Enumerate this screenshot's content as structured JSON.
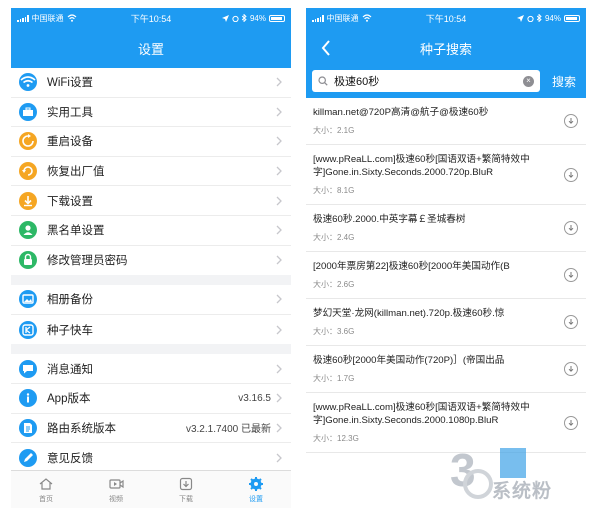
{
  "status_bar": {
    "carrier": "中国联通",
    "time": "下午10:54",
    "battery": "94%"
  },
  "settings": {
    "title": "设置",
    "groups": [
      [
        {
          "label": "WiFi设置",
          "icon": "wifi-icon",
          "color": "#1e9bf2"
        },
        {
          "label": "实用工具",
          "icon": "toolbox-icon",
          "color": "#1e9bf2"
        },
        {
          "label": "重启设备",
          "icon": "restart-icon",
          "color": "#f5a623"
        },
        {
          "label": "恢复出厂值",
          "icon": "factory-reset-icon",
          "color": "#f5a623"
        },
        {
          "label": "下载设置",
          "icon": "download-settings-icon",
          "color": "#f5a623"
        },
        {
          "label": "黑名单设置",
          "icon": "blacklist-icon",
          "color": "#2db866"
        },
        {
          "label": "修改管理员密码",
          "icon": "lock-icon",
          "color": "#2db866"
        }
      ],
      [
        {
          "label": "相册备份",
          "icon": "photo-backup-icon",
          "color": "#1e9bf2"
        },
        {
          "label": "种子快车",
          "icon": "torrent-express-icon",
          "color": "#1e9bf2"
        }
      ],
      [
        {
          "label": "消息通知",
          "icon": "message-icon",
          "color": "#1e9bf2"
        },
        {
          "label": "App版本",
          "value": "v3.16.5",
          "icon": "info-icon",
          "color": "#1e9bf2"
        },
        {
          "label": "路由系统版本",
          "value": "v3.2.1.7400 已最新",
          "icon": "document-icon",
          "color": "#1e9bf2"
        },
        {
          "label": "意见反馈",
          "icon": "feedback-icon",
          "color": "#1e9bf2"
        }
      ]
    ],
    "tabs": [
      {
        "label": "首页",
        "icon": "home-icon",
        "active": false
      },
      {
        "label": "视频",
        "icon": "video-icon",
        "active": false
      },
      {
        "label": "下载",
        "icon": "download-icon",
        "active": false
      },
      {
        "label": "设置",
        "icon": "settings-gear-icon",
        "active": true
      }
    ]
  },
  "search": {
    "title": "种子搜索",
    "query": "极速60秒",
    "button": "搜索",
    "size_prefix": "大小：",
    "results": [
      {
        "title": "killman.net@720P高清@航子@极速60秒",
        "size": "2.1G"
      },
      {
        "title": "[www.pReaLL.com]极速60秒[国语双语+繁简特效中字]Gone.in.Sixty.Seconds.2000.720p.BluR",
        "size": "8.1G"
      },
      {
        "title": "极速60秒.2000.中英字幕￡圣城春树",
        "size": "2.4G"
      },
      {
        "title": "[2000年票房第22]极速60秒[2000年美国动作(B",
        "size": "2.6G"
      },
      {
        "title": "梦幻天堂·龙网(killman.net).720p.极速60秒.惊",
        "size": "3.6G"
      },
      {
        "title": "极速60秒[2000年美国动作(720P)］(帝国出品",
        "size": "1.7G"
      },
      {
        "title": "[www.pReaLL.com]极速60秒[国语双语+繁简特效中字]Gone.in.Sixty.Seconds.2000.1080p.BluR",
        "size": "12.3G"
      }
    ]
  },
  "watermark": {
    "text": "系统粉"
  }
}
